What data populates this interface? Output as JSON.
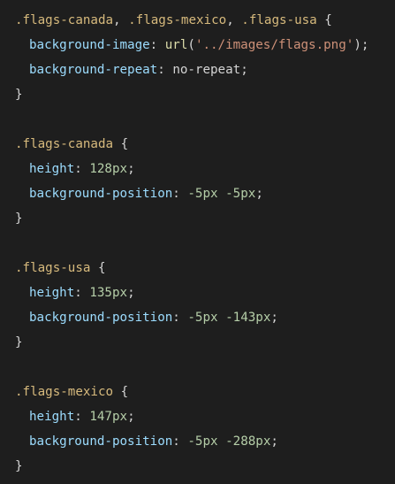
{
  "code": {
    "rules": [
      {
        "selectors": [
          ".flags-canada",
          ".flags-mexico",
          ".flags-usa"
        ],
        "declarations": [
          {
            "property": "background-image",
            "func": "url",
            "string": "'../images/flags.png'"
          },
          {
            "property": "background-repeat",
            "value": "no-repeat"
          }
        ]
      },
      {
        "selector": ".flags-canada",
        "height": {
          "num": "128",
          "unit": "px"
        },
        "position": {
          "x_num": "-5",
          "x_unit": "px",
          "y_num": "-5",
          "y_unit": "px"
        }
      },
      {
        "selector": ".flags-usa",
        "height": {
          "num": "135",
          "unit": "px"
        },
        "position": {
          "x_num": "-5",
          "x_unit": "px",
          "y_num": "-143",
          "y_unit": "px"
        }
      },
      {
        "selector": ".flags-mexico",
        "height": {
          "num": "147",
          "unit": "px"
        },
        "position": {
          "x_num": "-5",
          "x_unit": "px",
          "y_num": "-288",
          "y_unit": "px"
        }
      }
    ],
    "tokens": {
      "open_brace": "{",
      "close_brace": "}",
      "colon": ":",
      "semicolon": ";",
      "comma": ",",
      "open_paren": "(",
      "close_paren": ")",
      "height_prop": "height",
      "bgpos_prop": "background-position"
    }
  },
  "colors": {
    "background": "#1e1e1e",
    "selector": "#d7ba7d",
    "property": "#9cdcfe",
    "number": "#b5cea8",
    "string": "#ce9178",
    "function": "#dcdcaa",
    "default": "#d4d4d4"
  }
}
